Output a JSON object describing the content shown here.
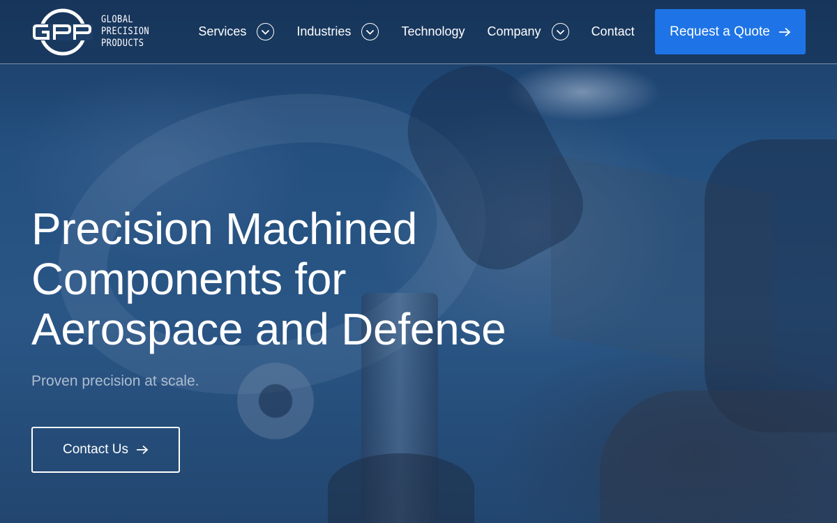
{
  "brand": {
    "mark": "GPP",
    "name_lines": [
      "GLOBAL",
      "PRECISION",
      "PRODUCTS"
    ]
  },
  "nav": {
    "items": [
      {
        "label": "Services",
        "has_dropdown": true
      },
      {
        "label": "Industries",
        "has_dropdown": true
      },
      {
        "label": "Technology",
        "has_dropdown": false
      },
      {
        "label": "Company",
        "has_dropdown": true
      },
      {
        "label": "Contact",
        "has_dropdown": false
      }
    ],
    "cta_label": "Request a Quote",
    "cta_icon": "arrow-right-icon",
    "dropdown_icon": "chevron-down-circle-icon"
  },
  "hero": {
    "title": "Precision Machined Components for Aerospace and Defense",
    "tagline": "Proven precision at scale.",
    "button_label": "Contact Us",
    "button_icon": "arrow-right-icon"
  },
  "colors": {
    "accent": "#1e74e6",
    "overlay": "#1d3f68",
    "text": "#ffffff",
    "tagline": "#aebdd0"
  }
}
